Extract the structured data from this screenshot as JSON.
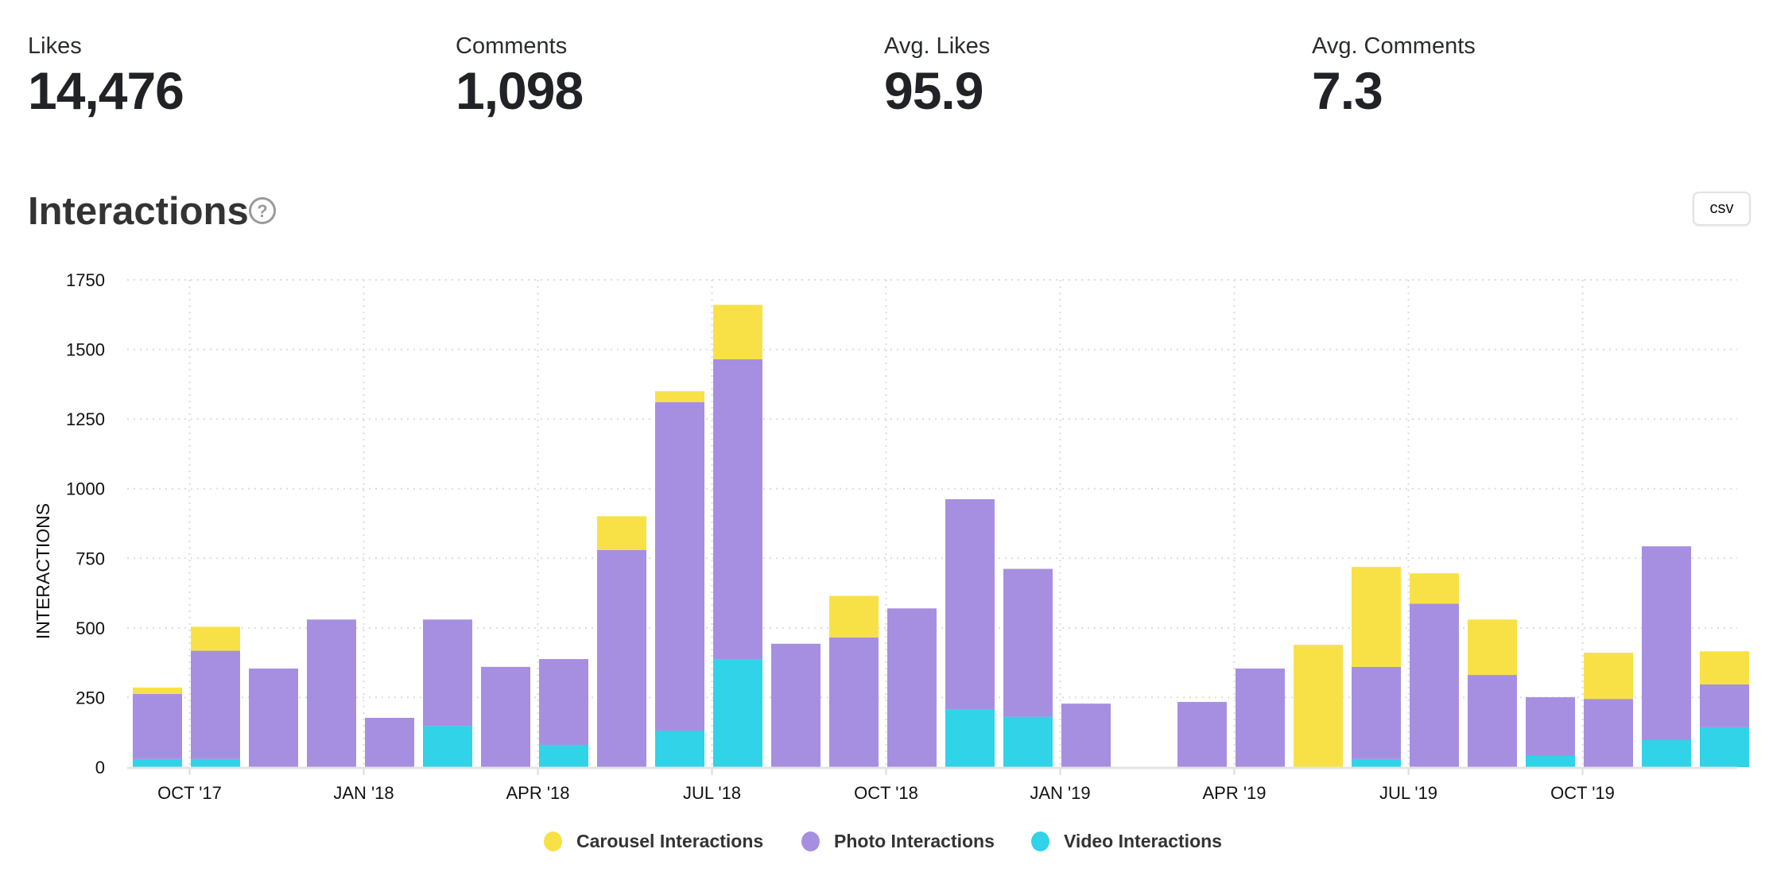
{
  "stats": [
    {
      "label": "Likes",
      "value": "14,476"
    },
    {
      "label": "Comments",
      "value": "1,098"
    },
    {
      "label": "Avg. Likes",
      "value": "95.9"
    },
    {
      "label": "Avg. Comments",
      "value": "7.3"
    }
  ],
  "section": {
    "title": "Interactions",
    "help_icon": "question-circle-icon",
    "help_glyph": "?",
    "csv_label": "csv"
  },
  "colors": {
    "carousel": "#f8e146",
    "photo": "#a68fe0",
    "video": "#30d3e8"
  },
  "chart_data": {
    "type": "bar",
    "stacked": true,
    "title": "Interactions",
    "xlabel": "",
    "ylabel": "INTERACTIONS",
    "ylim": [
      0,
      1750
    ],
    "yticks": [
      0,
      250,
      500,
      750,
      1000,
      1250,
      1500,
      1750
    ],
    "grid": true,
    "legend_position": "bottom-center",
    "categories": [
      "Sep '17",
      "Oct '17",
      "Nov '17",
      "Dec '17",
      "Jan '18",
      "Feb '18",
      "Mar '18",
      "Apr '18",
      "May '18",
      "Jun '18",
      "Jul '18",
      "Aug '18",
      "Sep '18",
      "Oct '18",
      "Nov '18",
      "Dec '18",
      "Jan '19",
      "Feb '19",
      "Mar '19",
      "Apr '19",
      "May '19",
      "Jun '19",
      "Jul '19",
      "Aug '19",
      "Sep '19",
      "Oct '19",
      "Nov '19",
      "Dec '19"
    ],
    "xtick_labels": [
      {
        "label": "OCT '17",
        "index": 1
      },
      {
        "label": "JAN '18",
        "index": 4
      },
      {
        "label": "APR '18",
        "index": 7
      },
      {
        "label": "JUL '18",
        "index": 10
      },
      {
        "label": "OCT '18",
        "index": 13
      },
      {
        "label": "JAN '19",
        "index": 16
      },
      {
        "label": "APR '19",
        "index": 19
      },
      {
        "label": "JUL '19",
        "index": 22
      },
      {
        "label": "OCT '19",
        "index": 25
      }
    ],
    "series": [
      {
        "name": "Video Interactions",
        "key": "video",
        "values": [
          29,
          29,
          0,
          0,
          0,
          148,
          0,
          80,
          0,
          130,
          387,
          0,
          0,
          0,
          206,
          181,
          0,
          0,
          0,
          0,
          0,
          29,
          0,
          0,
          40,
          0,
          97,
          143
        ]
      },
      {
        "name": "Photo Interactions",
        "key": "photo",
        "values": [
          234,
          389,
          354,
          530,
          177,
          382,
          360,
          308,
          780,
          1181,
          1078,
          443,
          466,
          570,
          756,
          531,
          228,
          0,
          234,
          354,
          0,
          331,
          587,
          331,
          211,
          245,
          696,
          154
        ]
      },
      {
        "name": "Carousel Interactions",
        "key": "carousel",
        "values": [
          23,
          86,
          0,
          0,
          0,
          0,
          0,
          0,
          121,
          39,
          195,
          0,
          149,
          0,
          0,
          0,
          0,
          0,
          0,
          0,
          439,
          359,
          109,
          199,
          0,
          166,
          0,
          119
        ]
      }
    ],
    "legend": [
      "Carousel Interactions",
      "Photo Interactions",
      "Video Interactions"
    ]
  }
}
